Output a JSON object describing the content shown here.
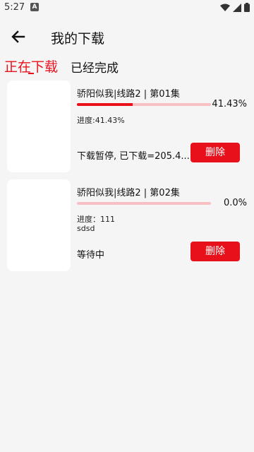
{
  "status_bar": {
    "time": "5:27",
    "a_badge": "A"
  },
  "header": {
    "title": "我的下载"
  },
  "tabs": [
    {
      "label": "正在下载",
      "active": true
    },
    {
      "label": "已经完成",
      "active": false
    }
  ],
  "colors": {
    "accent": "#e8111b",
    "track": "#f7c1c3"
  },
  "downloads": [
    {
      "title": "骄阳似我|线路2 | 第01集",
      "progress": 0.4143,
      "progress_label": "41.43%",
      "detail_line1": "进度:41.43%",
      "detail_line2": "",
      "status": "下载暂停, 已下载=205.4...",
      "delete_label": "删除"
    },
    {
      "title": "骄阳似我|线路2 | 第02集",
      "progress": 0.0,
      "progress_label": "0.0%",
      "detail_line1": "进度：111",
      "detail_line2": "sdsd",
      "status": "等待中",
      "delete_label": "删除"
    }
  ]
}
